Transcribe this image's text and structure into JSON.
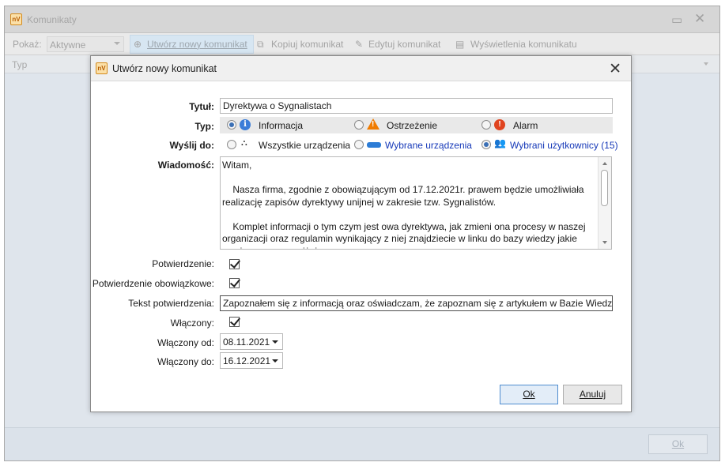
{
  "main": {
    "title": "Komunikaty",
    "toolbar": {
      "show_label": "Pokaż:",
      "show_value": "Aktywne",
      "new_label": "Utwórz nowy komunikat",
      "copy_label": "Kopiuj komunikat",
      "edit_label": "Edytuj komunikat",
      "views_label": "Wyświetlenia komunikatu"
    },
    "grid": {
      "column_type": "Typ"
    },
    "ok_label": "Ok"
  },
  "dialog": {
    "title": "Utwórz nowy komunikat",
    "title_label": "Tytuł:",
    "title_value": "Dyrektywa o Sygnalistach",
    "type_label": "Typ:",
    "type_options": [
      "Informacja",
      "Ostrzeżenie",
      "Alarm"
    ],
    "type_selected": "Informacja",
    "send_label": "Wyślij do:",
    "send_options": [
      "Wszystkie urządzenia",
      "Wybrane urządzenia",
      "Wybrani użytkownicy (15)"
    ],
    "send_selected": "Wybrani użytkownicy (15)",
    "message_label": "Wiadomość:",
    "message_text": "Witam,\n\n    Nasza firma, zgodnie z obowiązującym od 17.12.2021r. prawem będzie umożliwiała realizację zapisów dyrektywy unijnej w zakresie tzw. Sygnalistów.\n\n    Komplet informacji o tym czym jest owa dyrektywa, jak zmieni ona procesy w naszej organizacji oraz regulamin wynikający z niej znajdziecie w linku do bazy wiedzy jakie zamieszczamy poniżej.",
    "confirm_label": "Potwierdzenie:",
    "confirm_checked": true,
    "confirm_required_label": "Potwierdzenie obowiązkowe:",
    "confirm_required_checked": true,
    "confirm_text_label": "Tekst potwierdzenia:",
    "confirm_text_value": "Zapoznałem się z informacją oraz oświadczam, że zapoznam się z artykułem w Bazie Wiedzy.",
    "enabled_label": "Włączony:",
    "enabled_checked": true,
    "enabled_from_label": "Włączony od:",
    "enabled_from_value": "08.11.2021",
    "enabled_to_label": "Włączony do:",
    "enabled_to_value": "16.12.2021",
    "ok_label": "Ok",
    "cancel_label": "Anuluj"
  },
  "colors": {
    "accent_blue": "#1538b8",
    "info": "#3b7dd8",
    "warning": "#f07b00",
    "alarm": "#e04420"
  }
}
